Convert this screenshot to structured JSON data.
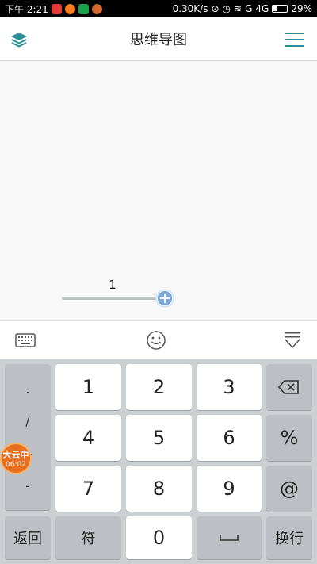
{
  "status_bar": {
    "time": "下午 2:21",
    "network_speed": "0.30K/s",
    "signal1": "G",
    "signal2": "4G",
    "battery": "29%",
    "battery_level": 0.29
  },
  "header": {
    "title": "思维导图",
    "left_icon": "layers-icon",
    "right_icon": "menu-icon"
  },
  "canvas": {
    "node_text": "1"
  },
  "toolbar": {
    "left_icon": "keyboard-icon",
    "center_icon": "emoji-icon",
    "right_icon": "collapse-keyboard-icon"
  },
  "keyboard": {
    "symbols": [
      ".",
      "/",
      "+",
      "-"
    ],
    "digits": [
      "1",
      "2",
      "3",
      "4",
      "5",
      "6",
      "7",
      "8",
      "9",
      "0"
    ],
    "percent": "%",
    "at": "@",
    "back": "返回",
    "symbol": "符",
    "newline": "换行"
  },
  "floating_badge": {
    "title": "大云中",
    "time": "06:02"
  }
}
